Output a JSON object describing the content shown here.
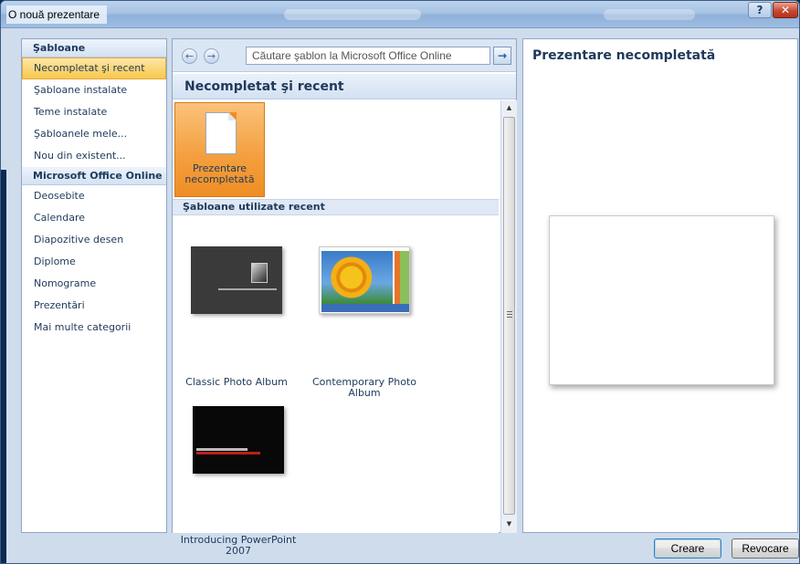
{
  "window": {
    "title": "O nouă prezentare",
    "help_label": "?",
    "close_label": "✕"
  },
  "sidebar": {
    "items": [
      {
        "label": "Şabloane",
        "type": "header"
      },
      {
        "label": "Necompletat şi recent",
        "selected": true
      },
      {
        "label": "Şabloane instalate"
      },
      {
        "label": "Teme instalate"
      },
      {
        "label": "Şabloanele mele..."
      },
      {
        "label": "Nou din existent..."
      },
      {
        "label": "Microsoft Office Online",
        "type": "header"
      },
      {
        "label": "Deosebite"
      },
      {
        "label": "Calendare"
      },
      {
        "label": "Diapozitive desen"
      },
      {
        "label": "Diplome"
      },
      {
        "label": "Nomograme"
      },
      {
        "label": "Prezentări"
      },
      {
        "label": "Mai multe categorii"
      }
    ]
  },
  "toolbar": {
    "back_icon": "←",
    "forward_icon": "→",
    "search_placeholder": "Căutare şablon la Microsoft Office Online",
    "go_icon": "→"
  },
  "main": {
    "heading": "Necompletat şi recent",
    "blank_tile_label_line1": "Prezentare",
    "blank_tile_label_line2": "necompletată",
    "recent_section_label": "Şabloane utilizate recent",
    "templates": [
      {
        "name_line1": "Classic Photo Album",
        "name_line2": ""
      },
      {
        "name_line1": "Contemporary Photo",
        "name_line2": "Album"
      },
      {
        "name_line1": "Introducing PowerPoint",
        "name_line2": "2007"
      }
    ]
  },
  "scrollbar": {
    "up_glyph": "▲",
    "down_glyph": "▼"
  },
  "preview": {
    "title": "Prezentare necompletată"
  },
  "buttons": {
    "create": "Creare",
    "cancel": "Revocare"
  },
  "colors": {
    "selection": "#f9c84b",
    "accent_text": "#1e395b",
    "close_button": "#c74a33"
  }
}
